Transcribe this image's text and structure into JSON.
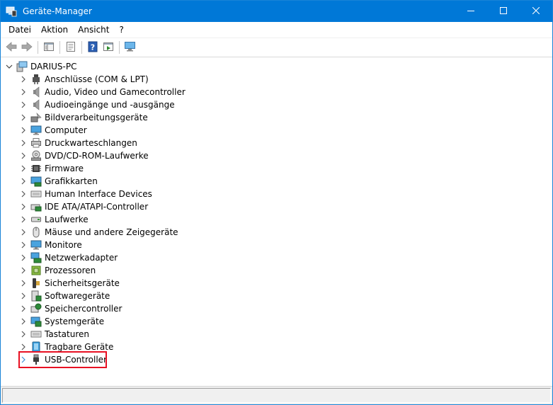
{
  "window": {
    "title": "Geräte-Manager",
    "accent": "#0078d7",
    "buttons": {
      "minimize": "minimize-icon",
      "maximize": "maximize-icon",
      "close": "close-icon"
    }
  },
  "menu": [
    "Datei",
    "Aktion",
    "Ansicht",
    "?"
  ],
  "toolbar": [
    "back-arrow-icon",
    "forward-arrow-icon",
    "show-hide-tree-icon",
    "properties-icon",
    "help-icon",
    "run-icon",
    "monitor-scan-icon"
  ],
  "tree": {
    "root": {
      "label": "DARIUS-PC",
      "expanded": true
    },
    "categories": [
      {
        "label": "Anschlüsse (COM & LPT)",
        "icon": "port-icon"
      },
      {
        "label": "Audio, Video und Gamecontroller",
        "icon": "speaker-icon"
      },
      {
        "label": "Audioeingänge und -ausgänge",
        "icon": "speaker-icon"
      },
      {
        "label": "Bildverarbeitungsgeräte",
        "icon": "camera-icon"
      },
      {
        "label": "Computer",
        "icon": "computer-icon"
      },
      {
        "label": "Druckwarteschlangen",
        "icon": "printer-icon"
      },
      {
        "label": "DVD/CD-ROM-Laufwerke",
        "icon": "disc-drive-icon"
      },
      {
        "label": "Firmware",
        "icon": "chip-icon"
      },
      {
        "label": "Grafikkarten",
        "icon": "display-adapter-icon"
      },
      {
        "label": "Human Interface Devices",
        "icon": "keyboard-icon"
      },
      {
        "label": "IDE ATA/ATAPI-Controller",
        "icon": "controller-icon"
      },
      {
        "label": "Laufwerke",
        "icon": "drive-icon"
      },
      {
        "label": "Mäuse und andere Zeigegeräte",
        "icon": "mouse-icon"
      },
      {
        "label": "Monitore",
        "icon": "monitor-icon"
      },
      {
        "label": "Netzwerkadapter",
        "icon": "network-adapter-icon"
      },
      {
        "label": "Prozessoren",
        "icon": "processor-icon"
      },
      {
        "label": "Sicherheitsgeräte",
        "icon": "security-key-icon"
      },
      {
        "label": "Softwaregeräte",
        "icon": "software-device-icon"
      },
      {
        "label": "Speichercontroller",
        "icon": "storage-controller-icon"
      },
      {
        "label": "Systemgeräte",
        "icon": "system-device-icon"
      },
      {
        "label": "Tastaturen",
        "icon": "keyboard-icon"
      },
      {
        "label": "Tragbare Geräte",
        "icon": "portable-device-icon"
      },
      {
        "label": "USB-Controller",
        "icon": "usb-icon",
        "highlighted": true
      }
    ]
  },
  "highlight_color": "#e81123"
}
